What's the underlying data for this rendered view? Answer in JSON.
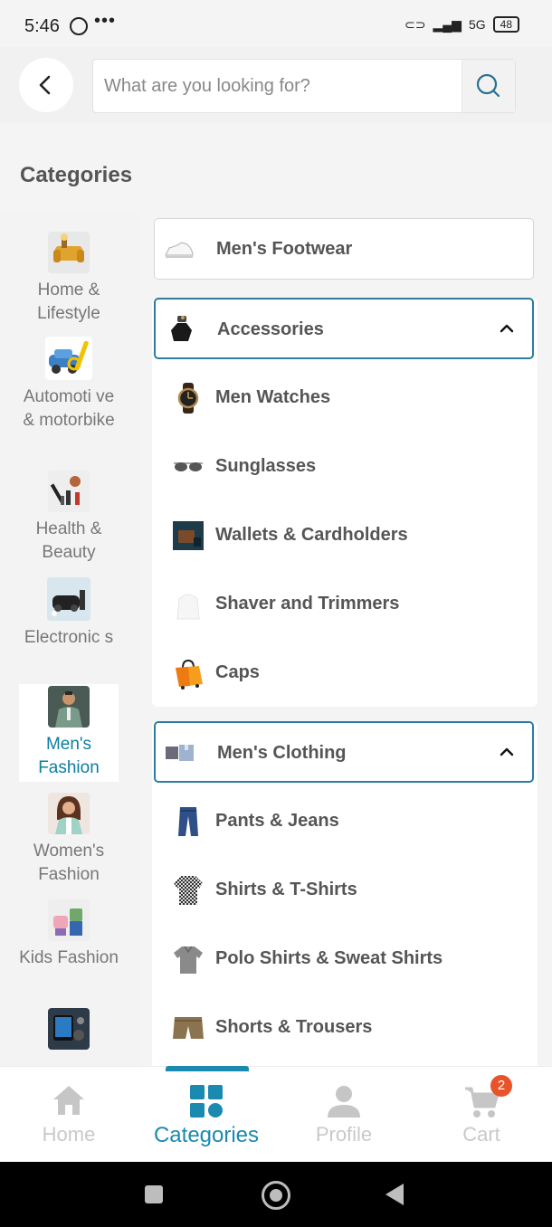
{
  "status_bar": {
    "time": "5:46",
    "dots": "•••",
    "network": "5G",
    "battery": "48"
  },
  "header": {
    "search_placeholder": "What are you looking for?"
  },
  "page_title": "Categories",
  "sidebar": {
    "items": [
      {
        "label": "Home & Lifestyle",
        "icon": "sofa-icon"
      },
      {
        "label": "Automoti ve & motorbike",
        "icon": "car-repair-icon"
      },
      {
        "label": "Health & Beauty",
        "icon": "beauty-tools-icon"
      },
      {
        "label": "Electronic s",
        "icon": "electronics-icon"
      },
      {
        "label": "Men's Fashion",
        "icon": "man-suit-icon",
        "active": true
      },
      {
        "label": "Women's Fashion",
        "icon": "woman-portrait-icon"
      },
      {
        "label": "Kids Fashion",
        "icon": "kids-clothes-icon"
      },
      {
        "label": "",
        "icon": "gadgets-icon"
      }
    ]
  },
  "groups": [
    {
      "title": "Men's Footwear",
      "icon": "sneaker-icon",
      "expanded": false
    },
    {
      "title": "Accessories",
      "icon": "perfume-icon",
      "expanded": true,
      "items": [
        {
          "label": "Men Watches",
          "icon": "watch-icon"
        },
        {
          "label": "Sunglasses",
          "icon": "sunglasses-icon"
        },
        {
          "label": "Wallets & Cardholders",
          "icon": "wallet-icon"
        },
        {
          "label": "Shaver and Trimmers",
          "icon": "shaver-icon"
        },
        {
          "label": "Caps",
          "icon": "shopping-bag-icon"
        }
      ]
    },
    {
      "title": "Men's Clothing",
      "icon": "shirts-icon",
      "expanded": true,
      "items": [
        {
          "label": "Pants & Jeans",
          "icon": "jeans-icon"
        },
        {
          "label": "Shirts & T-Shirts",
          "icon": "checked-shirt-icon"
        },
        {
          "label": "Polo Shirts & Sweat Shirts",
          "icon": "polo-shirt-icon"
        },
        {
          "label": "Shorts & Trousers",
          "icon": "shorts-icon"
        }
      ]
    }
  ],
  "bottom_nav": {
    "items": [
      {
        "label": "Home",
        "icon": "home-icon"
      },
      {
        "label": "Categories",
        "icon": "grid-icon",
        "active": true
      },
      {
        "label": "Profile",
        "icon": "person-icon"
      },
      {
        "label": "Cart",
        "icon": "cart-icon",
        "badge": "2"
      }
    ]
  },
  "colors": {
    "accent": "#1a8ab0",
    "active_border": "#2a7ea0",
    "badge": "#e8532a"
  }
}
